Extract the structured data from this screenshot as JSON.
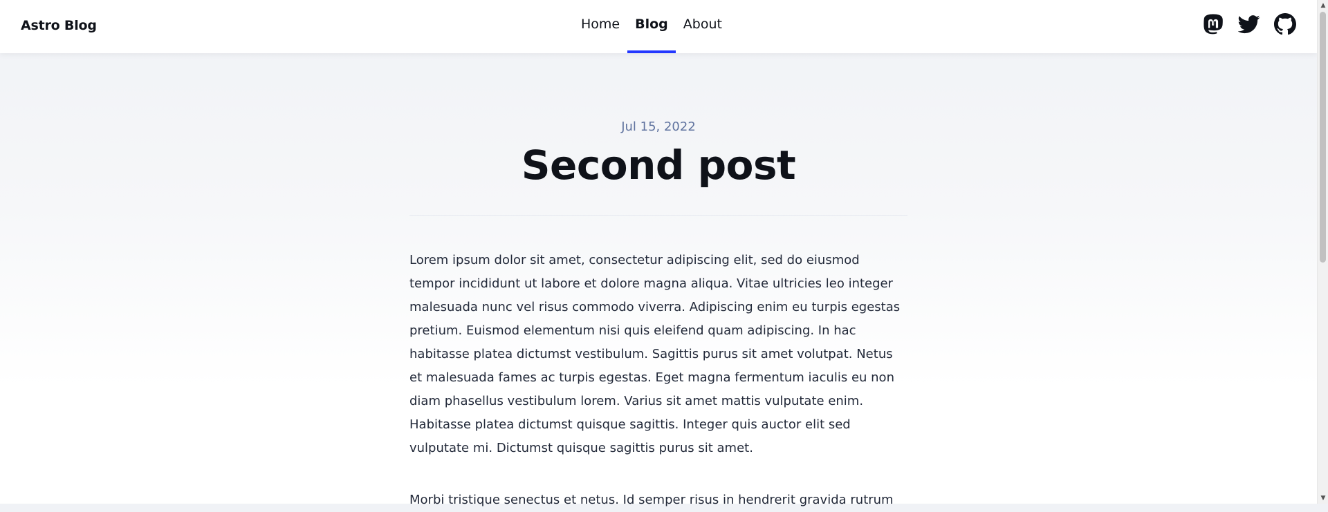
{
  "header": {
    "brand": "Astro Blog",
    "nav": [
      {
        "label": "Home",
        "active": false
      },
      {
        "label": "Blog",
        "active": true
      },
      {
        "label": "About",
        "active": false
      }
    ],
    "social_icons": [
      "mastodon-icon",
      "twitter-icon",
      "github-icon"
    ],
    "accent_color": "#2337ff"
  },
  "post": {
    "date": "Jul 15, 2022",
    "title": "Second post",
    "paragraphs": [
      "Lorem ipsum dolor sit amet, consectetur adipiscing elit, sed do eiusmod tempor incididunt ut labore et dolore magna aliqua. Vitae ultricies leo integer malesuada nunc vel risus commodo viverra. Adipiscing enim eu turpis egestas pretium. Euismod elementum nisi quis eleifend quam adipiscing. In hac habitasse platea dictumst vestibulum. Sagittis purus sit amet volutpat. Netus et malesuada fames ac turpis egestas. Eget magna fermentum iaculis eu non diam phasellus vestibulum lorem. Varius sit amet mattis vulputate enim. Habitasse platea dictumst quisque sagittis. Integer quis auctor elit sed vulputate mi. Dictumst quisque sagittis purus sit amet.",
      "Morbi tristique senectus et netus. Id semper risus in hendrerit gravida rutrum"
    ]
  }
}
